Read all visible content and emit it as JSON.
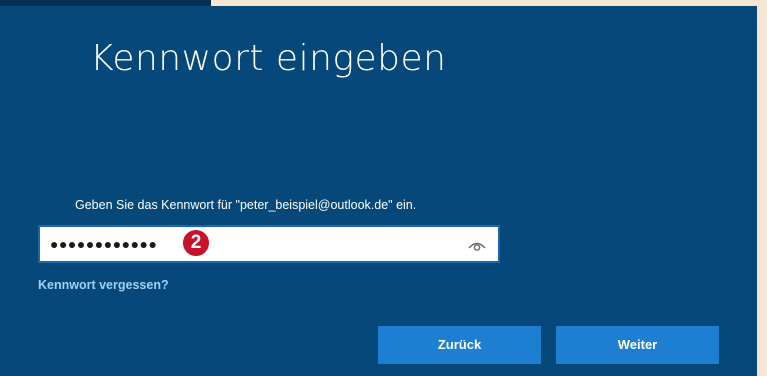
{
  "dialog": {
    "title": "Kennwort eingeben",
    "prompt": "Geben Sie das Kennwort für \"peter_beispiel@outlook.de\" ein.",
    "password_field": {
      "masked_value": "●●●●●●●●●●●●",
      "reveal_icon": "eye-icon"
    },
    "step_badge": "2",
    "forgot_link": "Kennwort vergessen?",
    "buttons": {
      "back_label": "Zurück",
      "next_label": "Weiter"
    }
  },
  "colors": {
    "dialog_background": "#054879",
    "button_background": "#1d7fd2",
    "link_color": "#9fd0f3",
    "badge_color": "#c8112a",
    "field_border": "#1c66ad",
    "page_background": "#f6e7d2"
  }
}
